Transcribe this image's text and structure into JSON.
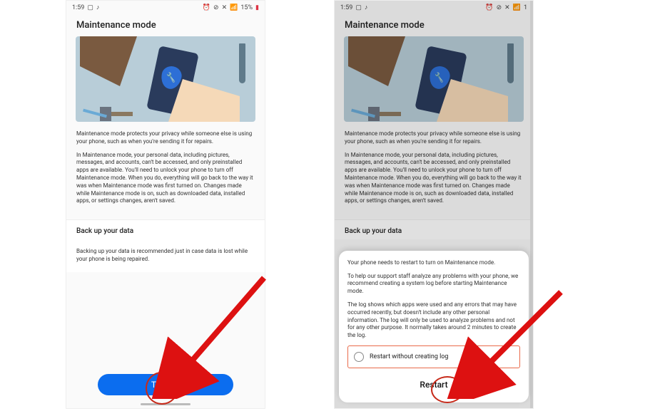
{
  "status": {
    "time": "1:59",
    "indicators": [
      "▢",
      "♪"
    ],
    "right_icons": [
      "⏰",
      "⊘",
      "✕",
      "📶"
    ],
    "battery": "15%"
  },
  "title": "Maintenance mode",
  "paragraphs": {
    "p1": "Maintenance mode protects your privacy while someone else is using your phone, such as when you're sending it for repairs.",
    "p2": "In Maintenance mode, your personal data, including pictures, messages, and accounts, can't be accessed, and only preinstalled apps are available. You'll need to unlock your phone to turn off Maintenance mode. When you do, everything will go back to the way it was when Maintenance mode was first turned on. Changes made while Maintenance mode is on, such as downloaded data, installed apps, or settings changes, aren't saved."
  },
  "backup": {
    "header": "Back up your data",
    "body": "Backing up your data is recommended just in case data is lost while your phone is being repaired."
  },
  "turn_on_label": "Turn on",
  "sheet": {
    "p1": "Your phone needs to restart to turn on Maintenance mode.",
    "p2": "To help our support staff analyze any problems with your phone, we recommend creating a system log before starting Maintenance mode.",
    "p3": "The log shows which apps were used and any errors that may have occurred recently, but doesn't include any other personal information. The log will only be used to analyze problems and not for any other purpose. It normally takes around 2 minutes to create the log.",
    "checkbox_label": "Restart without creating log",
    "restart_label": "Restart"
  }
}
